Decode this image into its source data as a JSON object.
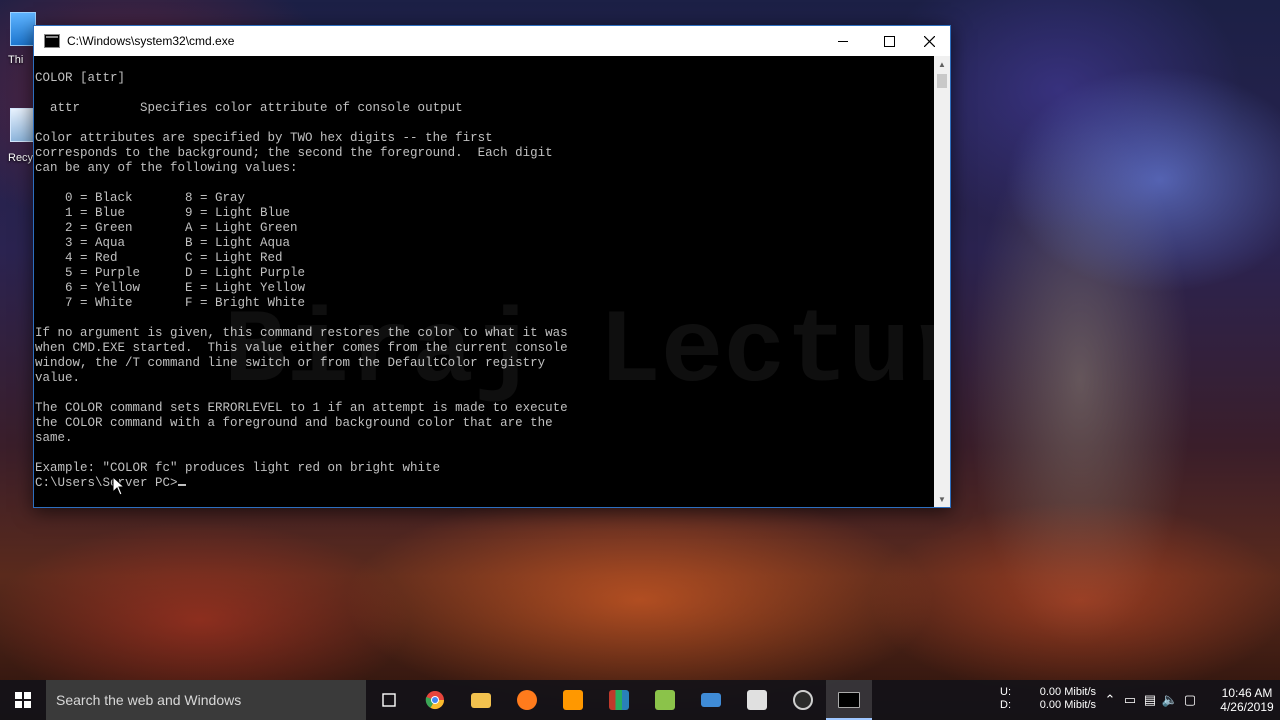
{
  "desktop": {
    "icons": [
      {
        "label": "Thi",
        "icon": "this-pc-icon"
      },
      {
        "label": "Recyc",
        "icon": "recycle-bin-icon"
      }
    ],
    "watermark": "Biraj Lecture"
  },
  "window": {
    "title": "C:\\Windows\\system32\\cmd.exe",
    "controls": {
      "minimize": "minimize-icon",
      "maximize": "maximize-icon",
      "close": "close-icon"
    }
  },
  "console": {
    "text": "COLOR [attr]\n\n  attr        Specifies color attribute of console output\n\nColor attributes are specified by TWO hex digits -- the first\ncorresponds to the background; the second the foreground.  Each digit\ncan be any of the following values:\n\n    0 = Black       8 = Gray\n    1 = Blue        9 = Light Blue\n    2 = Green       A = Light Green\n    3 = Aqua        B = Light Aqua\n    4 = Red         C = Light Red\n    5 = Purple      D = Light Purple\n    6 = Yellow      E = Light Yellow\n    7 = White       F = Bright White\n\nIf no argument is given, this command restores the color to what it was\nwhen CMD.EXE started.  This value either comes from the current console\nwindow, the /T command line switch or from the DefaultColor registry\nvalue.\n\nThe COLOR command sets ERRORLEVEL to 1 if an attempt is made to execute\nthe COLOR command with a foreground and background color that are the\nsame.\n\nExample: \"COLOR fc\" produces light red on bright white\n",
    "prompt": "C:\\Users\\Server PC>",
    "text_color": "#c0c0c0",
    "background": "#000000"
  },
  "taskbar": {
    "search_placeholder": "Search the web and Windows",
    "apps": [
      {
        "name": "task-view",
        "color": "#ffffff"
      },
      {
        "name": "chrome",
        "color": "#e8453c"
      },
      {
        "name": "file-explorer",
        "color": "#f2c14e"
      },
      {
        "name": "firefox",
        "color": "#ff7b1c"
      },
      {
        "name": "sublime-text",
        "color": "#ff9800"
      },
      {
        "name": "winrar",
        "color": "#7b4ea3"
      },
      {
        "name": "notepad-plus",
        "color": "#8bc34a"
      },
      {
        "name": "remote-desktop",
        "color": "#3f8bd6"
      },
      {
        "name": "screenshot-tool",
        "color": "#e0e0e0"
      },
      {
        "name": "obs-studio",
        "color": "#cfcfcf"
      },
      {
        "name": "cmd",
        "color": "#000000"
      }
    ],
    "network": {
      "up_label": "U:",
      "up_value": "0.00 Mibit/s",
      "down_label": "D:",
      "down_value": "0.00 Mibit/s"
    },
    "clock": {
      "time": "10:46 AM",
      "date": "4/26/2019"
    }
  }
}
